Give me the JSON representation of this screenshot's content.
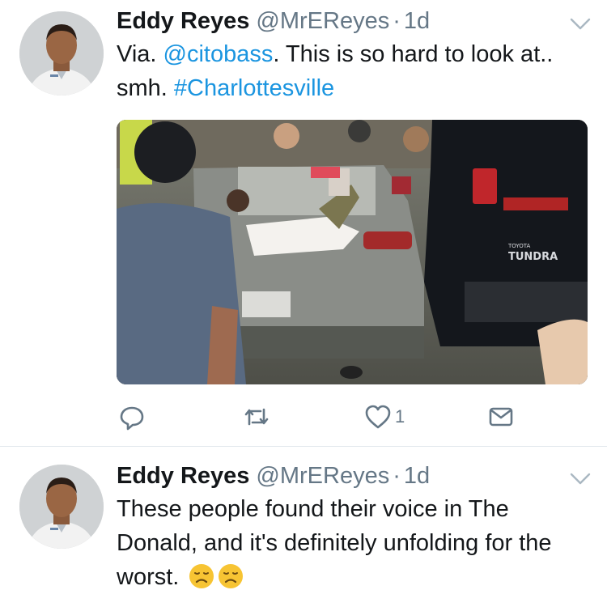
{
  "tweets": [
    {
      "author_name": "Eddy Reyes",
      "handle": "@MrEReyes",
      "separator": "·",
      "time": "1d",
      "text_parts": [
        "Via. ",
        "@citobass",
        ". This is so hard to look at.. smh. ",
        "#Charlottesville"
      ],
      "media_text": {
        "truck_model": "TUNDRA",
        "truck_make": "TOYOTA"
      },
      "actions": {
        "reply_count": "",
        "retweet_count": "",
        "like_count": "1"
      }
    },
    {
      "author_name": "Eddy Reyes",
      "handle": "@MrEReyes",
      "separator": "·",
      "time": "1d",
      "text": "These people found their voice in The Donald, and it's definitely unfolding for the worst.",
      "emojis": [
        "disappointed-face",
        "disappointed-face"
      ]
    }
  ],
  "colors": {
    "link": "#1b95e0",
    "secondary": "#657786",
    "divider": "#e1e8ed"
  }
}
